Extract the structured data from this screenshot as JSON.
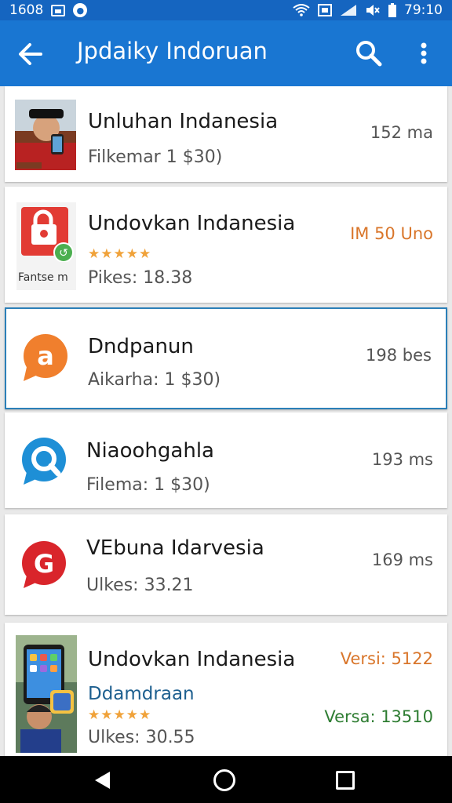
{
  "status_bar": {
    "time_left": "1608",
    "time_right": "79:10"
  },
  "app_bar": {
    "title": "Jpdaiky Indoruan"
  },
  "items": [
    {
      "title": "Unluhan Indanesia",
      "subtitle": "Filkemar 1 $30)",
      "meta": "152 ma",
      "icon": "photo-thumbnail"
    },
    {
      "title": "Undovkan Indanesia",
      "thumb_caption": "Fantse m",
      "subtitle": "Pikes: 18.38",
      "meta": "IM 50 Uno",
      "stars": "★★★★★",
      "icon": "red-bag-icon"
    },
    {
      "title": "Dndpanun",
      "subtitle": "Aikarha: 1 $30)",
      "meta": "198 bes",
      "icon": "orange-chat-icon"
    },
    {
      "title": "Niaoohgahla",
      "subtitle": "Filema: 1 $30)",
      "meta": "193 ms",
      "icon": "blue-search-bubble-icon"
    },
    {
      "title": "VEbuna Idarvesia",
      "subtitle": "Ulkes: 33.21",
      "meta": "169 ms",
      "icon": "red-g-bubble-icon"
    },
    {
      "title": "Undovkan Indanesia",
      "developer": "Ddamdraan",
      "subtitle": "Ulkes: 30.55",
      "meta_top": "Versi: 5122",
      "meta_bottom": "Versa: 13510",
      "stars": "★★★★★",
      "icon": "phone-photo-thumbnail"
    }
  ],
  "colors": {
    "app_bar": "#1976d2",
    "status_bar": "#1565c0",
    "accent_orange": "#d9762b",
    "version_green": "#2e7d32"
  }
}
